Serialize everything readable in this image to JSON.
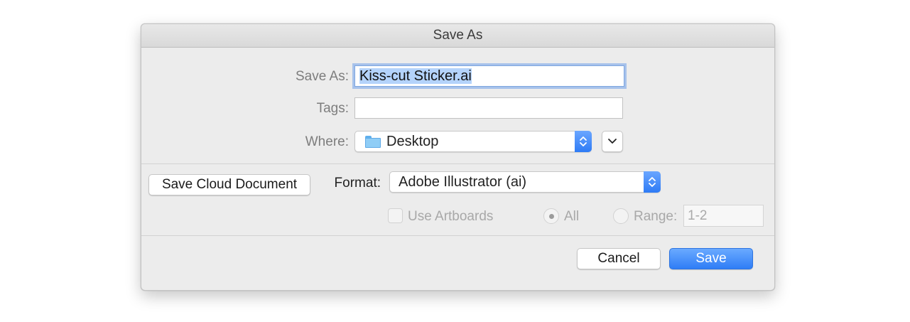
{
  "window": {
    "title": "Save As"
  },
  "form": {
    "save_as_label": "Save As:",
    "filename": "Kiss-cut Sticker.ai",
    "tags_label": "Tags:",
    "tags_value": "",
    "where_label": "Where:",
    "where_value": "Desktop"
  },
  "options": {
    "cloud_button": "Save Cloud Document",
    "format_label": "Format:",
    "format_value": "Adobe Illustrator (ai)",
    "use_artboards_label": "Use Artboards",
    "all_label": "All",
    "range_label": "Range:",
    "range_value": "1-2"
  },
  "actions": {
    "cancel": "Cancel",
    "save": "Save"
  },
  "colors": {
    "accent": "#2f7df6",
    "selection": "#b4d3fb",
    "dialog_bg": "#ececec"
  }
}
